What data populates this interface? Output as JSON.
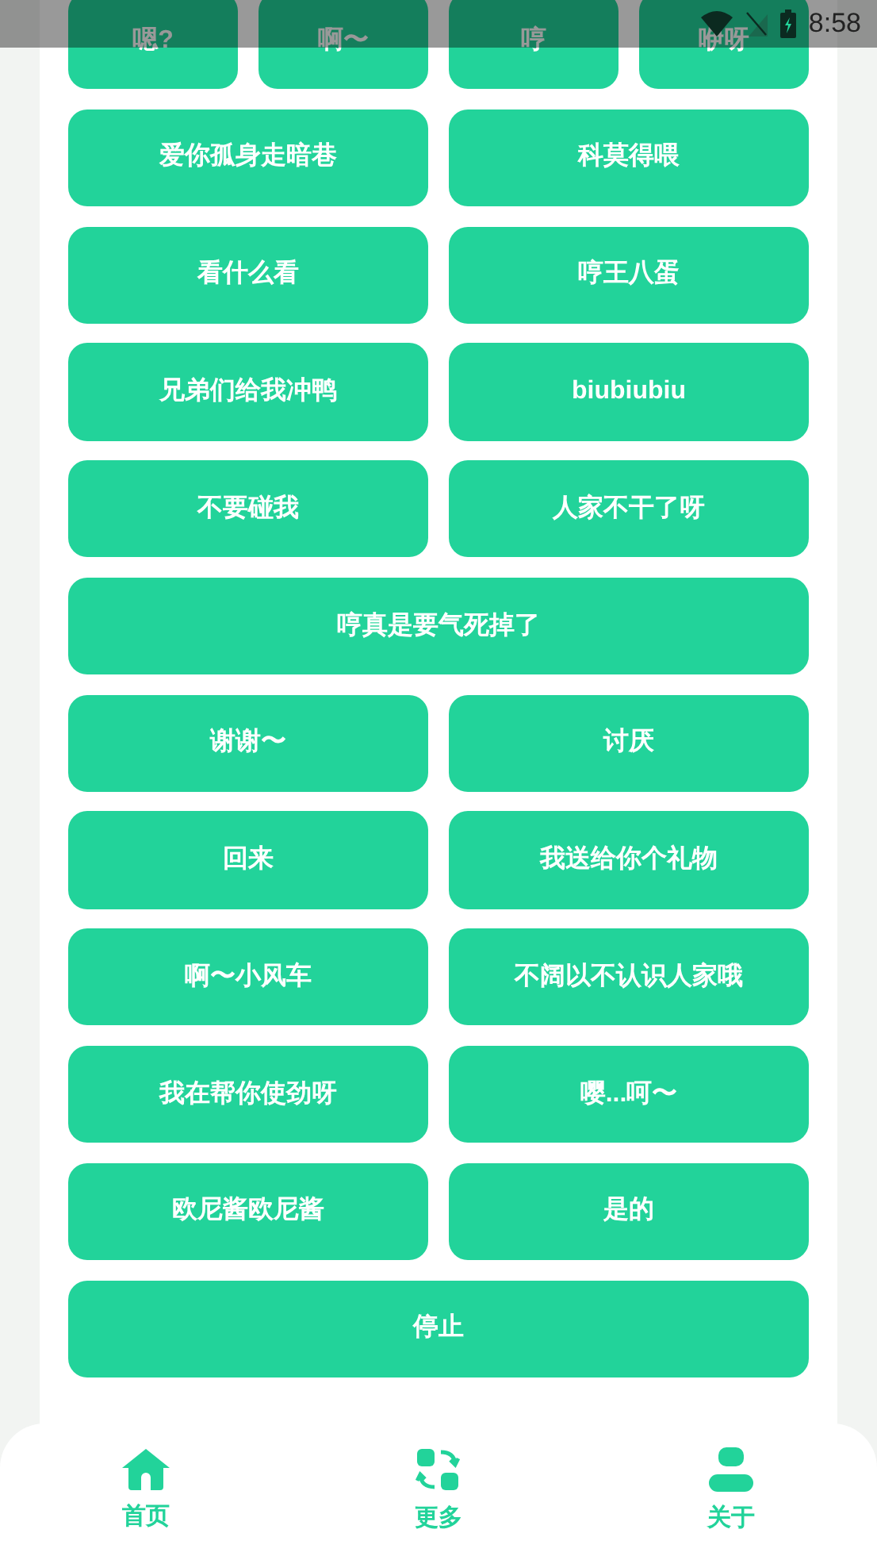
{
  "status_bar": {
    "time": "8:58"
  },
  "buttons": [
    {
      "label": "嗯?",
      "kind": "quarter"
    },
    {
      "label": "啊〜",
      "kind": "quarter"
    },
    {
      "label": "哼",
      "kind": "quarter"
    },
    {
      "label": "咿呀",
      "kind": "quarter"
    },
    {
      "label": "爱你孤身走暗巷",
      "kind": "half"
    },
    {
      "label": "科莫得喂",
      "kind": "half"
    },
    {
      "label": "看什么看",
      "kind": "half"
    },
    {
      "label": "哼王八蛋",
      "kind": "half"
    },
    {
      "label": "兄弟们给我冲鸭",
      "kind": "half"
    },
    {
      "label": "biubiubiu",
      "kind": "half"
    },
    {
      "label": "不要碰我",
      "kind": "half"
    },
    {
      "label": "人家不干了呀",
      "kind": "half"
    },
    {
      "label": "哼真是要气死掉了",
      "kind": "full"
    },
    {
      "label": "谢谢〜",
      "kind": "half"
    },
    {
      "label": "讨厌",
      "kind": "half"
    },
    {
      "label": "回来",
      "kind": "half"
    },
    {
      "label": "我送给你个礼物",
      "kind": "half"
    },
    {
      "label": "啊〜小风车",
      "kind": "half"
    },
    {
      "label": "不阔以不认识人家哦",
      "kind": "half"
    },
    {
      "label": "我在帮你使劲呀",
      "kind": "half"
    },
    {
      "label": "嘤...呵〜",
      "kind": "half"
    },
    {
      "label": "欧尼酱欧尼酱",
      "kind": "half"
    },
    {
      "label": "是的",
      "kind": "half"
    },
    {
      "label": "停止",
      "kind": "full"
    }
  ],
  "bottom_nav": [
    {
      "label": "首页",
      "kind": "home"
    },
    {
      "label": "更多",
      "kind": "swap"
    },
    {
      "label": "关于",
      "kind": "user"
    }
  ]
}
